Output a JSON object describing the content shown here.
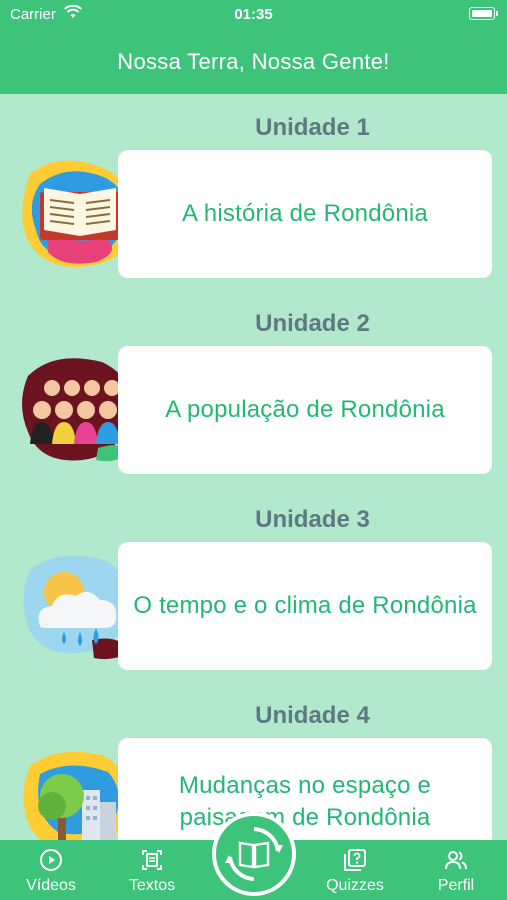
{
  "status_bar": {
    "carrier": "Carrier",
    "time": "01:35"
  },
  "header": {
    "title": "Nossa Terra, Nossa Gente!"
  },
  "units": [
    {
      "label": "Unidade 1",
      "title": "A história de Rondônia",
      "icon": "book-icon"
    },
    {
      "label": "Unidade 2",
      "title": "A população de Rondônia",
      "icon": "people-icon"
    },
    {
      "label": "Unidade 3",
      "title": "O tempo e o clima de Rondônia",
      "icon": "weather-icon"
    },
    {
      "label": "Unidade 4",
      "title": "Mudanças no espaço e paisagem de Rondônia",
      "icon": "landscape-icon"
    }
  ],
  "tabbar": {
    "videos": "Vídeos",
    "textos": "Textos",
    "quizzes": "Quizzes",
    "perfil": "Perfil"
  },
  "colors": {
    "primary": "#3dc47a",
    "background": "#b2e8cc",
    "card_text": "#22b873",
    "unit_label": "#5d7a82"
  }
}
